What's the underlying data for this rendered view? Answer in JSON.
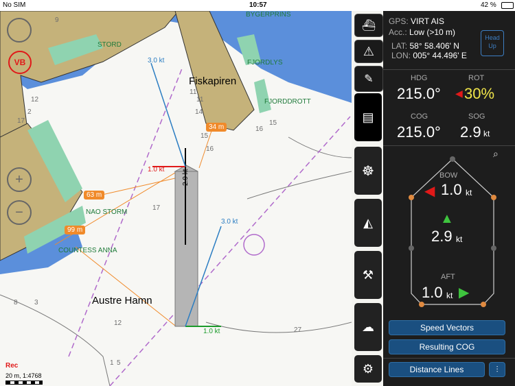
{
  "status": {
    "carrier": "No SIM",
    "time": "10:57",
    "battery": "42 %"
  },
  "map": {
    "labels": {
      "stord": "STORD",
      "fjordlys": "FJORDLYS",
      "fjorddrott": "FJORDDROTT",
      "fiskapiren": "Fiskapiren",
      "nao_storm": "NAO STORM",
      "countess_anna": "COUNTESS ANNA",
      "austre_hamn": "Austre Hamn",
      "bygerpr": "BYGERPRINS"
    },
    "callouts": {
      "d34": "34 m",
      "d63": "63 m",
      "d99": "99 m"
    },
    "vectors": {
      "bow": "1.0 kt",
      "stern": "1.0 kt",
      "speed": "2.9 kt",
      "stbd_a": "3.0 kt",
      "stbd_b": "3.0 kt"
    },
    "depths": [
      "11",
      "14",
      "15",
      "16",
      "16",
      "17",
      "12",
      "1",
      "5",
      "9",
      "12",
      "17",
      "8",
      "3",
      "27",
      "15",
      "11",
      "2"
    ],
    "rec": "Rec",
    "scale": "20 m, 1:4768",
    "vb": "VB"
  },
  "panel": {
    "gps_label": "GPS:",
    "gps_value": "VIRT AIS",
    "acc_label": "Acc.:",
    "acc_value": "Low (>10 m)",
    "lat_label": "LAT:",
    "lat_value": "58° 58.406' N",
    "lon_label": "LON:",
    "lon_value": "005° 44.496' E",
    "head_up": [
      "Head",
      "Up"
    ],
    "hdg_label": "HDG",
    "hdg_value": "215.0°",
    "rot_label": "ROT",
    "rot_value": "30%",
    "cog_label": "COG",
    "cog_value": "215.0°",
    "sog_label": "SOG",
    "sog_value": "2.9",
    "sog_unit": "kt",
    "bow_label": "BOW",
    "bow_value": "1.0",
    "bow_unit": "kt",
    "mid_value": "2.9",
    "mid_unit": "kt",
    "aft_label": "AFT",
    "aft_value": "1.0",
    "aft_unit": "kt",
    "btn_speed_vectors": "Speed Vectors",
    "btn_resulting_cog": "Resulting COG",
    "btn_distance_lines": "Distance Lines"
  },
  "colors": {
    "land": "#c5b27a",
    "water": "#5b8fdb",
    "panel": "#1d1d1d",
    "button": "#1a4f80",
    "accent_red": "#e01919",
    "accent_green": "#3ec43e",
    "accent_yellow": "#f0e54a"
  }
}
